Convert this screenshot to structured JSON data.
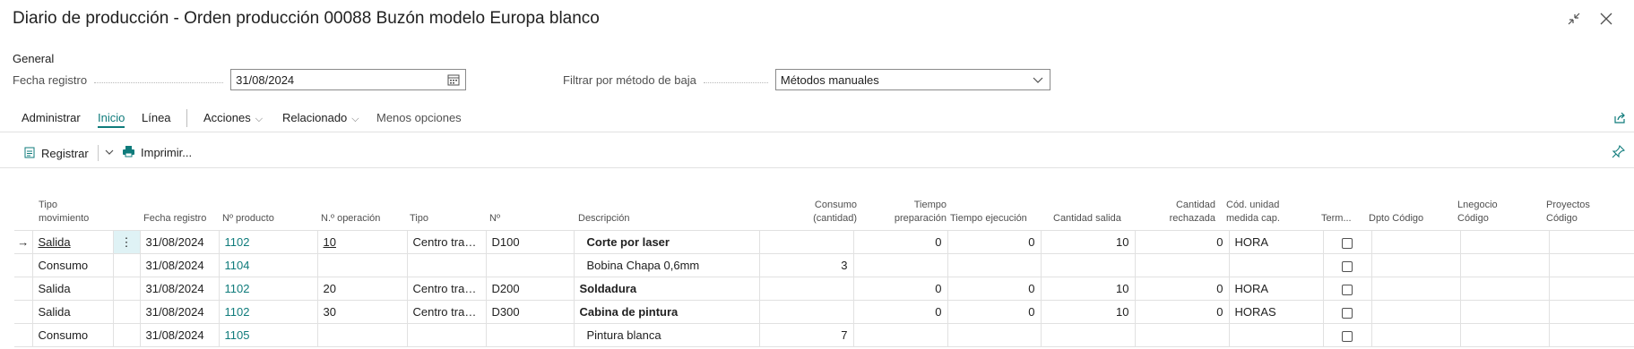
{
  "title": "Diario de producción - Orden producción 00088 Buzón modelo Europa blanco",
  "window": {
    "collapse_icon": "collapse-icon",
    "close_icon": "close-icon"
  },
  "general": {
    "section_label": "General",
    "fecha_registro_label": "Fecha registro",
    "fecha_registro_value": "31/08/2024",
    "filtrar_label": "Filtrar por método de baja",
    "filtrar_value": "Métodos manuales"
  },
  "actionbar": {
    "items": [
      "Administrar",
      "Inicio",
      "Línea",
      "Acciones",
      "Relacionado",
      "Menos opciones"
    ]
  },
  "commands": {
    "registrar": "Registrar",
    "imprimir": "Imprimir..."
  },
  "table": {
    "headers": {
      "tipo_mov": [
        "Tipo",
        "movimiento"
      ],
      "fecha": "Fecha registro",
      "producto": "Nº producto",
      "operacion": "N.º operación",
      "tipo": "Tipo",
      "no": "Nº",
      "descripcion": "Descripción",
      "consumo": [
        "Consumo",
        "(cantidad)"
      ],
      "tiempo_prep": [
        "Tiempo",
        "preparación"
      ],
      "tiempo_ejec": "Tiempo ejecución",
      "cantidad_salida": "Cantidad salida",
      "cantidad_rech": [
        "Cantidad",
        "rechazada"
      ],
      "cod_unidad": [
        "Cód. unidad",
        "medida cap."
      ],
      "term": "Term...",
      "dpto": "Dpto Código",
      "linegocio": [
        "Lnegocio",
        "Código"
      ],
      "proyectos": [
        "Proyectos",
        "Código"
      ]
    },
    "rows": [
      {
        "tipo_mov": "Salida",
        "fecha": "31/08/2024",
        "producto": "1102",
        "operacion": "10",
        "tipo": "Centro traba...",
        "no": "D100",
        "descripcion": "Corte por laser",
        "consumo": "",
        "tiempo_prep": "0",
        "tiempo_ejec": "0",
        "cantidad_salida": "10",
        "cantidad_rech": "0",
        "cod_unidad": "HORA"
      },
      {
        "tipo_mov": "Consumo",
        "fecha": "31/08/2024",
        "producto": "1104",
        "operacion": "",
        "tipo": "",
        "no": "",
        "descripcion": "Bobina Chapa 0,6mm",
        "consumo": "3",
        "tiempo_prep": "",
        "tiempo_ejec": "",
        "cantidad_salida": "",
        "cantidad_rech": "",
        "cod_unidad": ""
      },
      {
        "tipo_mov": "Salida",
        "fecha": "31/08/2024",
        "producto": "1102",
        "operacion": "20",
        "tipo": "Centro traba...",
        "no": "D200",
        "descripcion": "Soldadura",
        "consumo": "",
        "tiempo_prep": "0",
        "tiempo_ejec": "0",
        "cantidad_salida": "10",
        "cantidad_rech": "0",
        "cod_unidad": "HORA"
      },
      {
        "tipo_mov": "Salida",
        "fecha": "31/08/2024",
        "producto": "1102",
        "operacion": "30",
        "tipo": "Centro traba...",
        "no": "D300",
        "descripcion": "Cabina de pintura",
        "consumo": "",
        "tiempo_prep": "0",
        "tiempo_ejec": "0",
        "cantidad_salida": "10",
        "cantidad_rech": "0",
        "cod_unidad": "HORAS"
      },
      {
        "tipo_mov": "Consumo",
        "fecha": "31/08/2024",
        "producto": "1105",
        "operacion": "",
        "tipo": "",
        "no": "",
        "descripcion": "Pintura blanca",
        "consumo": "7",
        "tiempo_prep": "",
        "tiempo_ejec": "",
        "cantidad_salida": "",
        "cantidad_rech": "",
        "cod_unidad": ""
      }
    ]
  },
  "colors": {
    "accent": "#0f7b7b",
    "selected_cell": "#dff2f5",
    "border": "#e1e1e1"
  }
}
